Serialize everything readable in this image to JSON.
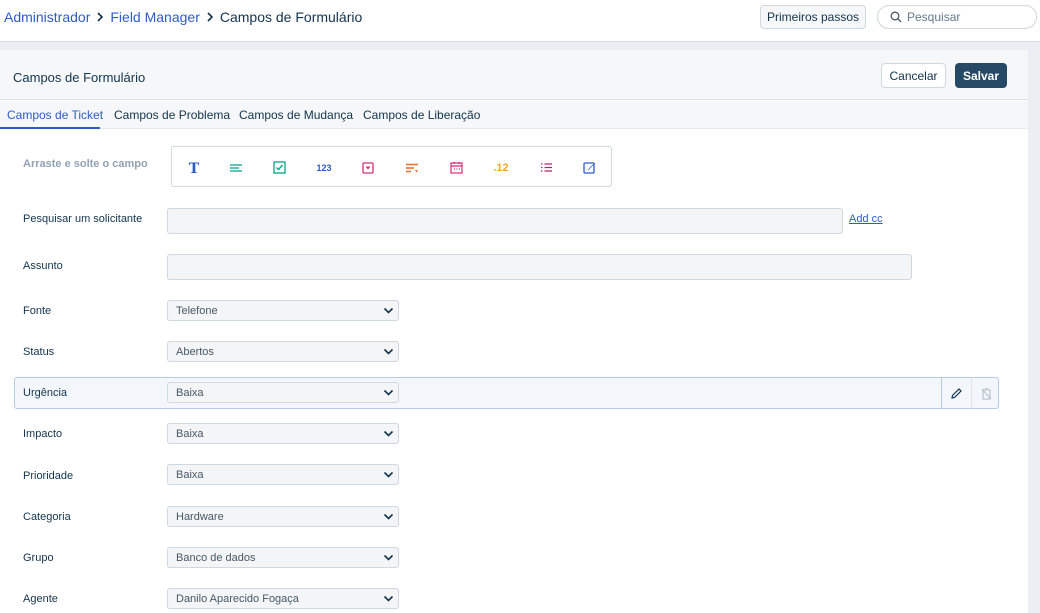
{
  "breadcrumb": {
    "items": [
      "Administrador",
      "Field Manager"
    ],
    "current": "Campos de Formulário"
  },
  "header": {
    "getting_started": "Primeiros passos",
    "search_placeholder": "Pesquisar"
  },
  "panel": {
    "title": "Campos de Formulário",
    "cancel_label": "Cancelar",
    "save_label": "Salvar"
  },
  "tabs": [
    {
      "label": "Campos de Ticket",
      "active": true
    },
    {
      "label": "Campos de Problema",
      "active": false
    },
    {
      "label": "Campos de Mudança",
      "active": false
    },
    {
      "label": "Campos de Liberação",
      "active": false
    }
  ],
  "toolbar": {
    "drag_label": "Arraste e solte o campo",
    "number_label": "123",
    "decimal_label": ".12",
    "icons": [
      "text-field-icon",
      "paragraph-icon",
      "checkbox-icon",
      "number-icon",
      "dropdown-icon",
      "dependent-field-icon",
      "date-icon",
      "decimal-icon",
      "multi-select-icon",
      "content-field-icon"
    ]
  },
  "colors": {
    "accent": "#2c5cc5",
    "primary_button": "#264966",
    "text_icon": "#2c5cc5",
    "paragraph_icon": "#00a886",
    "checkbox_icon": "#00a886",
    "number_icon": "#2c5cc5",
    "dropdown_icon": "#d72d77",
    "dependent_icon": "#e86f25",
    "date_icon": "#d72d77",
    "decimal_icon": "#f5a623",
    "multiselect_icon": "#b4236c",
    "content_icon": "#2c5cc5"
  },
  "form": {
    "requester_label": "Pesquisar um solicitante",
    "add_cc": "Add cc",
    "subject_label": "Assunto",
    "fields": [
      {
        "label": "Fonte",
        "value": "Telefone"
      },
      {
        "label": "Status",
        "value": "Abertos"
      },
      {
        "label": "Urgência",
        "value": "Baixa"
      },
      {
        "label": "Impacto",
        "value": "Baixa"
      },
      {
        "label": "Prioridade",
        "value": "Baixa"
      },
      {
        "label": "Categoria",
        "value": "Hardware"
      },
      {
        "label": "Grupo",
        "value": "Banco de dados"
      },
      {
        "label": "Agente",
        "value": "Danilo Aparecido Fogaça"
      }
    ]
  }
}
